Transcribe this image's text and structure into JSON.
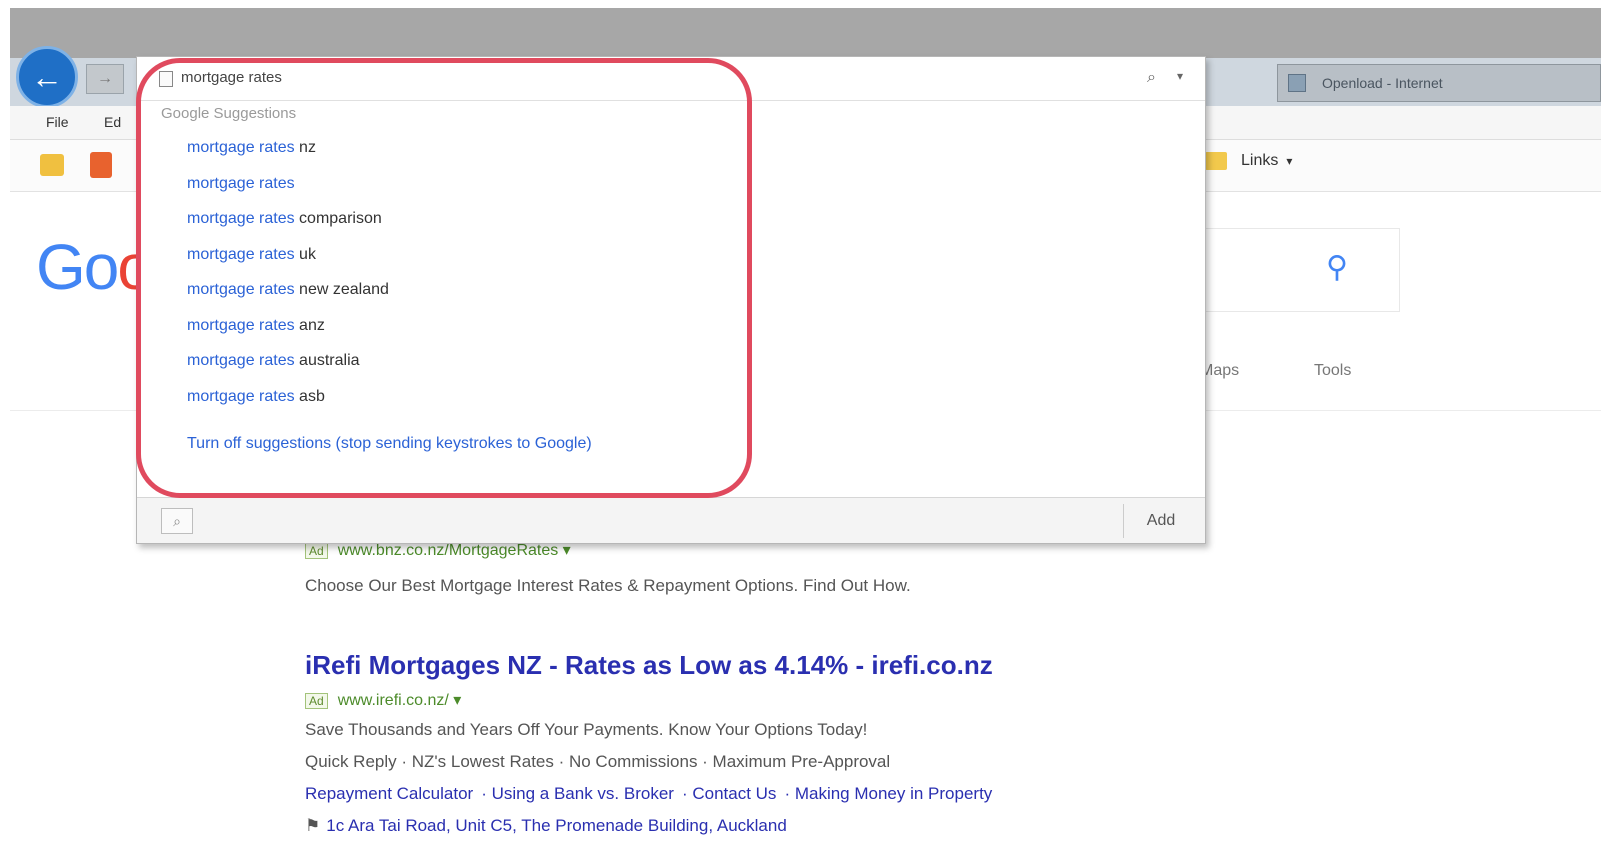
{
  "browser": {
    "tab_title": "Openload - Internet",
    "menu": [
      "File",
      "Ed"
    ],
    "links_label": "Links",
    "back_glyph": "←",
    "forward_glyph": "→"
  },
  "address_bar": {
    "value": "mortgage rates",
    "search_glyph": "⌕",
    "dropdown_glyph": "▾",
    "lock_glyph": "▾"
  },
  "suggestions": {
    "header": "Google Suggestions",
    "items": [
      {
        "query": "mortgage rates",
        "rest": " nz"
      },
      {
        "query": "mortgage rates",
        "rest": ""
      },
      {
        "query": "mortgage rates",
        "rest": " comparison"
      },
      {
        "query": "mortgage rates",
        "rest": " uk"
      },
      {
        "query": "mortgage rates",
        "rest": " new zealand"
      },
      {
        "query": "mortgage rates",
        "rest": " anz"
      },
      {
        "query": "mortgage rates",
        "rest": " australia"
      },
      {
        "query": "mortgage rates",
        "rest": " asb"
      }
    ],
    "turn_off": "Turn off suggestions (stop sending keystrokes to Google)"
  },
  "dropdown_footer": {
    "add_label": "Add",
    "search_glyph": "⌕"
  },
  "google": {
    "logo_part1": "Go",
    "logo_part2": "o",
    "search_glyph": "⚲",
    "tabs": [
      "Maps",
      "Tools"
    ]
  },
  "results": {
    "ad_label": "Ad",
    "r1": {
      "url": "www.bnz.co.nz/MortgageRates",
      "desc": "Choose Our Best Mortgage Interest Rates & Repayment Options. Find Out How."
    },
    "r2": {
      "title": "iRefi Mortgages NZ - Rates as Low as 4.14% - irefi.co.nz",
      "url": "www.irefi.co.nz/",
      "desc1": "Save Thousands and Years Off Your Payments. Know Your Options Today!",
      "desc2": "Quick Reply · NZ's Lowest Rates · No Commissions · Maximum Pre-Approval",
      "sitelinks": [
        "Repayment Calculator",
        "Using a Bank vs. Broker",
        "Contact Us",
        "Making Money in Property"
      ],
      "address": "1c Ara Tai Road, Unit C5, The Promenade Building, Auckland"
    }
  }
}
